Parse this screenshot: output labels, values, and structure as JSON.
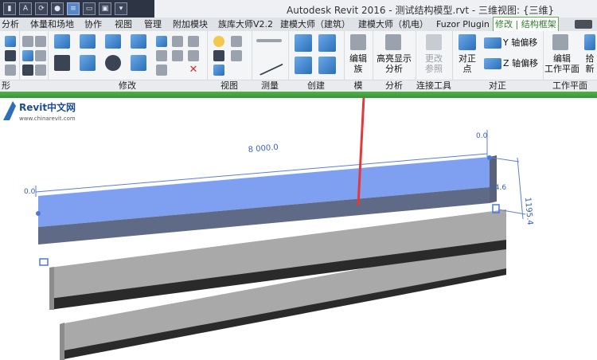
{
  "window": {
    "title": "Autodesk Revit 2016 -      测试结构模型.rvt - 三维视图: {三维}"
  },
  "tabs": [
    {
      "label": "分析"
    },
    {
      "label": "体量和场地"
    },
    {
      "label": "协作"
    },
    {
      "label": "视图"
    },
    {
      "label": "管理"
    },
    {
      "label": "附加模块"
    },
    {
      "label": "族库大师V2.2"
    },
    {
      "label": "建模大师（建筑）"
    },
    {
      "label": "建模大师（机电）"
    },
    {
      "label": "Fuzor Plugin"
    },
    {
      "label": "修改 | 结构框架",
      "active": true
    }
  ],
  "ribbon": {
    "groups": [
      {
        "label": "形"
      },
      {
        "label": "修改"
      },
      {
        "label": "视图"
      },
      {
        "label": "测量"
      },
      {
        "label": "创建"
      },
      {
        "label": "模"
      },
      {
        "label": "分析"
      },
      {
        "label": "连接工具"
      },
      {
        "label": "对正"
      },
      {
        "label": "工作平面"
      }
    ],
    "buttons": {
      "edit_family": "编辑\n族",
      "highlight_analysis": "高亮显示\n分析",
      "change_reference": "更改\n参照",
      "align_point": "对正\n点",
      "y_axis_offset": "Y 轴偏移",
      "z_axis_offset": "Z 轴偏移",
      "edit_workplane": "编辑\n工作平面",
      "pick_new": "拾\n新"
    }
  },
  "viewport": {
    "dimension_length": "8 000.0",
    "dimension_height": "1195.4",
    "offset_left": "0.0",
    "offset_right": "0.0",
    "offset_mid": "54.6",
    "colors": {
      "selected_top": "#7f9ff0",
      "selected_side": "#5f6a86",
      "beam_top": "#a9a9a9",
      "beam_side": "#2a2a2a",
      "arrow": "#e23a3a",
      "dim_line": "#5b7fd6"
    }
  },
  "watermark": {
    "brand": "Revit中文网",
    "url": "www.chinarevit.com"
  }
}
